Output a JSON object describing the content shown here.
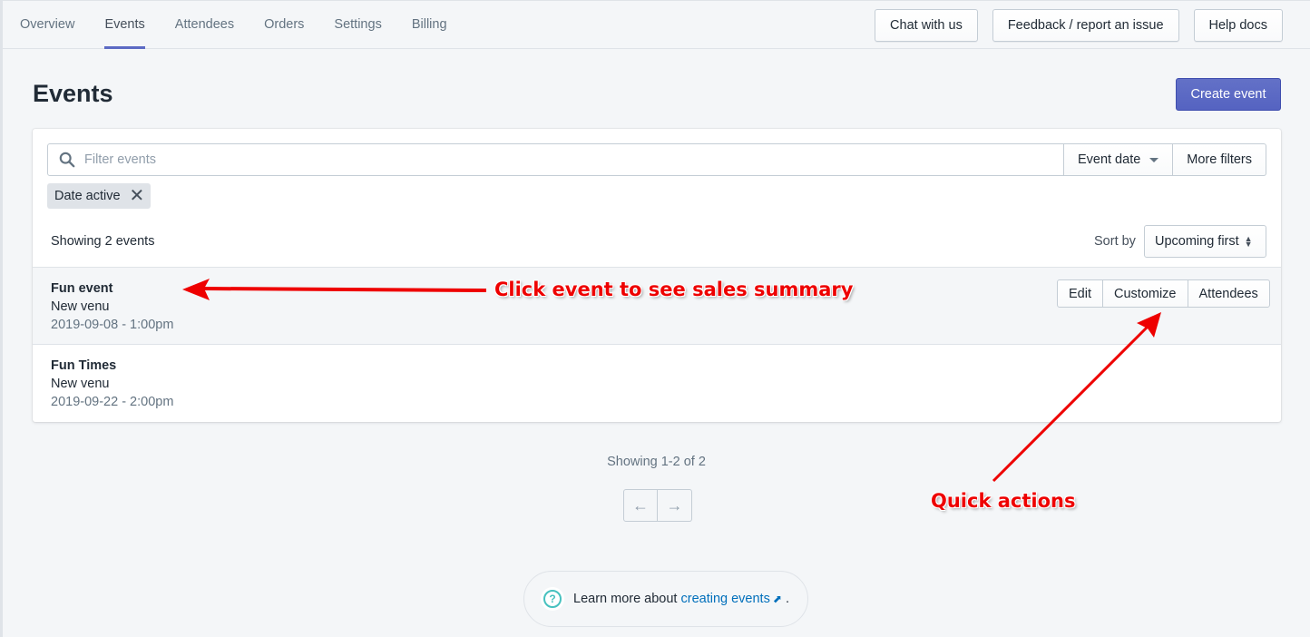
{
  "nav": {
    "tabs": [
      {
        "label": "Overview",
        "active": false
      },
      {
        "label": "Events",
        "active": true
      },
      {
        "label": "Attendees",
        "active": false
      },
      {
        "label": "Orders",
        "active": false
      },
      {
        "label": "Settings",
        "active": false
      },
      {
        "label": "Billing",
        "active": false
      }
    ],
    "actions": [
      "Chat with us",
      "Feedback / report an issue",
      "Help docs"
    ]
  },
  "page": {
    "title": "Events",
    "primary_action": "Create event",
    "accent_color": "#5c6ac4"
  },
  "filters": {
    "search_placeholder": "Filter events",
    "search_value": "",
    "event_date_label": "Event date",
    "more_filters_label": "More filters",
    "applied_tag": "Date active"
  },
  "list": {
    "showing_text": "Showing 2 events",
    "sort_label": "Sort by",
    "sort_value": "Upcoming first",
    "events": [
      {
        "name": "Fun event",
        "venue": "New venu",
        "datetime": "2019-09-08 - 1:00pm"
      },
      {
        "name": "Fun Times",
        "venue": "New venu",
        "datetime": "2019-09-22 - 2:00pm"
      }
    ],
    "quick_actions": [
      "Edit",
      "Customize",
      "Attendees"
    ]
  },
  "pagination": {
    "text": "Showing 1-2 of 2",
    "prev_icon": "arrow-left-icon",
    "next_icon": "arrow-right-icon"
  },
  "footer": {
    "prefix": "Learn more about",
    "link_text": "creating events",
    "suffix": "."
  },
  "annotations": {
    "click_event": "Click event to see sales summary",
    "quick_actions": "Quick actions",
    "color": "#ee0000"
  }
}
